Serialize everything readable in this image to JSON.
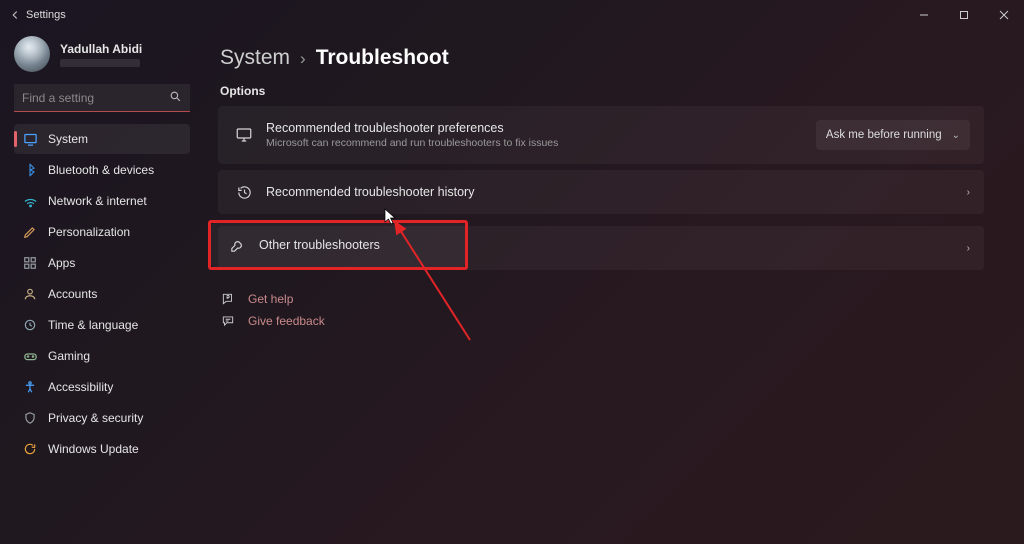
{
  "window": {
    "title": "Settings"
  },
  "user": {
    "name": "Yadullah Abidi"
  },
  "search": {
    "placeholder": "Find a setting"
  },
  "sidebar": {
    "items": [
      {
        "label": "System"
      },
      {
        "label": "Bluetooth & devices"
      },
      {
        "label": "Network & internet"
      },
      {
        "label": "Personalization"
      },
      {
        "label": "Apps"
      },
      {
        "label": "Accounts"
      },
      {
        "label": "Time & language"
      },
      {
        "label": "Gaming"
      },
      {
        "label": "Accessibility"
      },
      {
        "label": "Privacy & security"
      },
      {
        "label": "Windows Update"
      }
    ]
  },
  "breadcrumb": {
    "parent": "System",
    "current": "Troubleshoot"
  },
  "section_label": "Options",
  "cards": {
    "recommended_prefs": {
      "title": "Recommended troubleshooter preferences",
      "subtitle": "Microsoft can recommend and run troubleshooters to fix issues",
      "dropdown": "Ask me before running"
    },
    "history": {
      "title": "Recommended troubleshooter history"
    },
    "other": {
      "title": "Other troubleshooters"
    }
  },
  "links": {
    "help": "Get help",
    "feedback": "Give feedback"
  }
}
